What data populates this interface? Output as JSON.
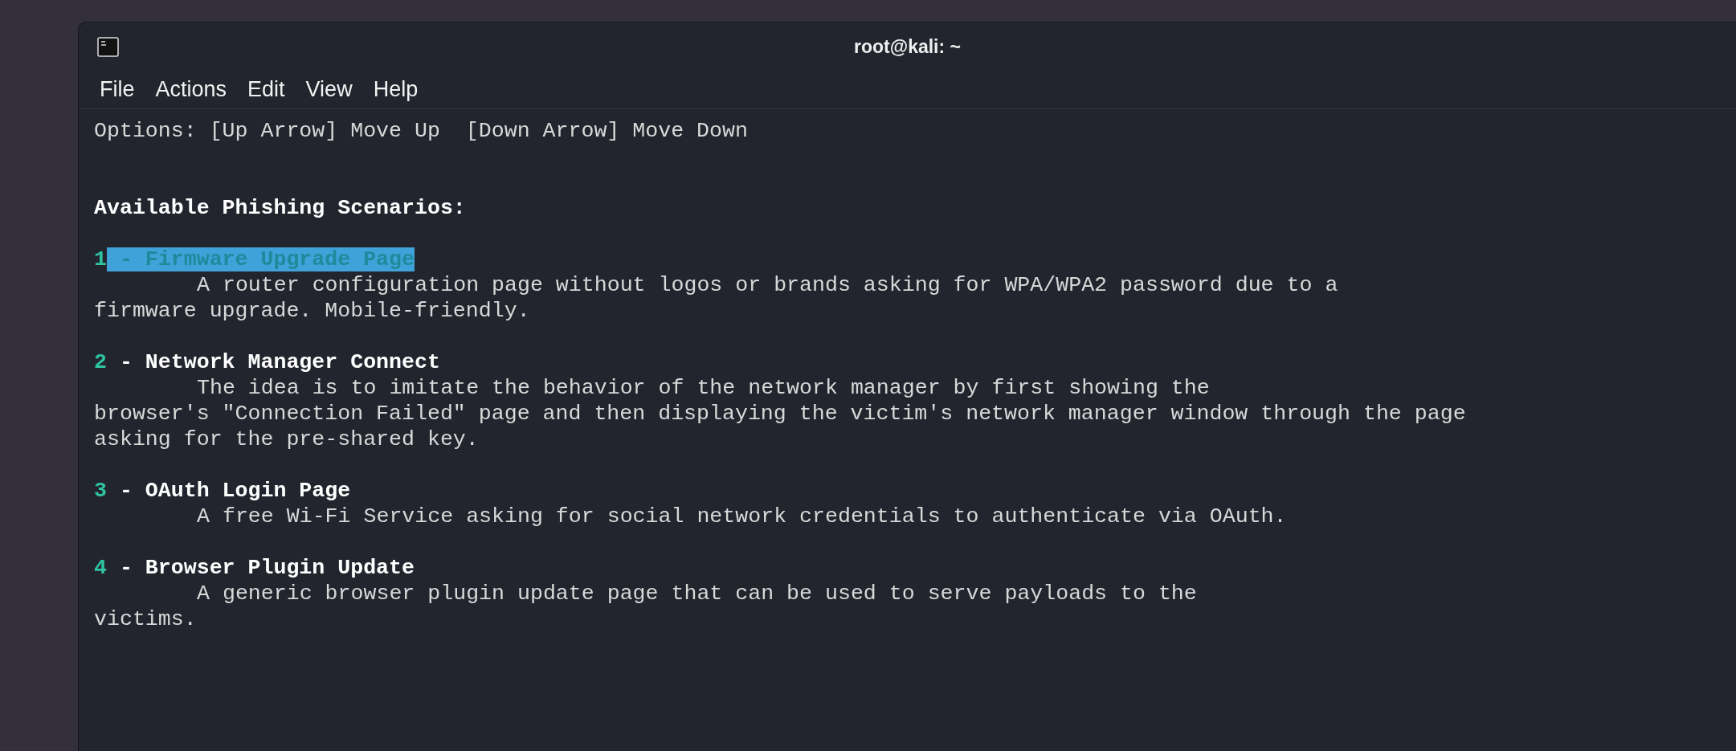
{
  "window": {
    "title": "root@kali: ~"
  },
  "menu": [
    "File",
    "Actions",
    "Edit",
    "View",
    "Help"
  ],
  "options_line": "Options: [Up Arrow] Move Up  [Down Arrow] Move Down",
  "heading": "Available Phishing Scenarios:",
  "scenarios": [
    {
      "number": "1",
      "title": " - Firmware Upgrade Page",
      "selected": true,
      "description_lines": [
        "A router configuration page without logos or brands asking for WPA/WPA2 password due to a",
        "firmware upgrade. Mobile-friendly."
      ]
    },
    {
      "number": "2",
      "title": " - Network Manager Connect",
      "selected": false,
      "description_lines": [
        "The idea is to imitate the behavior of the network manager by first showing the",
        "browser's \"Connection Failed\" page and then displaying the victim's network manager window through the page",
        "asking for the pre-shared key."
      ]
    },
    {
      "number": "3",
      "title": " - OAuth Login Page",
      "selected": false,
      "description_lines": [
        "A free Wi-Fi Service asking for social network credentials to authenticate via OAuth."
      ]
    },
    {
      "number": "4",
      "title": " - Browser Plugin Update",
      "selected": false,
      "description_lines": [
        "A generic browser plugin update page that can be used to serve payloads to the",
        "victims."
      ]
    }
  ]
}
